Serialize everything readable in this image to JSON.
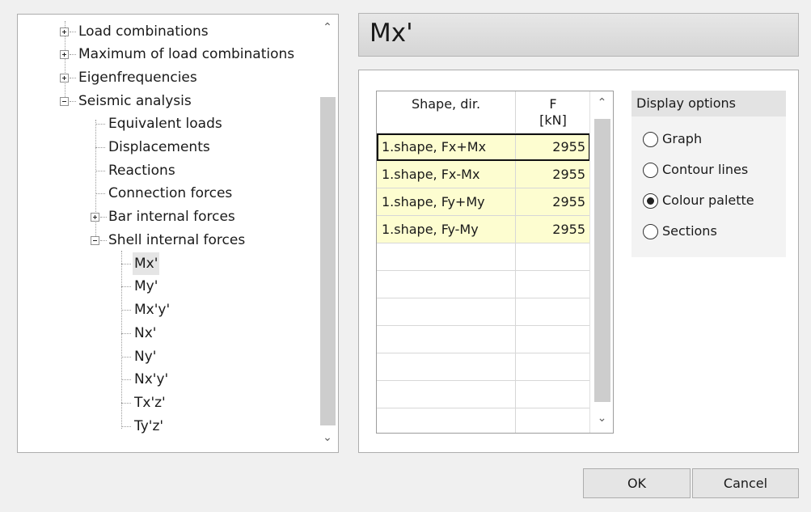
{
  "tree": {
    "items": [
      {
        "label": "Load combinations",
        "expander": "plus"
      },
      {
        "label": "Maximum of load combinations",
        "expander": "plus"
      },
      {
        "label": "Eigenfrequencies",
        "expander": "plus"
      },
      {
        "label": "Seismic analysis",
        "expander": "minus"
      },
      {
        "label": "Equivalent loads"
      },
      {
        "label": "Displacements"
      },
      {
        "label": "Reactions"
      },
      {
        "label": "Connection forces"
      },
      {
        "label": "Bar internal forces",
        "expander": "plus"
      },
      {
        "label": "Shell internal forces",
        "expander": "minus"
      },
      {
        "label": "Mx'",
        "selected": true
      },
      {
        "label": "My'"
      },
      {
        "label": "Mx'y'"
      },
      {
        "label": "Nx'"
      },
      {
        "label": "Ny'"
      },
      {
        "label": "Nx'y'"
      },
      {
        "label": "Tx'z'"
      },
      {
        "label": "Ty'z'"
      }
    ]
  },
  "header": {
    "title": "Mx'"
  },
  "grid": {
    "columns": [
      "Shape, dir.",
      "F",
      "[kN]"
    ],
    "rows": [
      {
        "shape": "1.shape, Fx+Mx",
        "f": "2955"
      },
      {
        "shape": "1.shape, Fx-Mx",
        "f": "2955"
      },
      {
        "shape": "1.shape, Fy+My",
        "f": "2955"
      },
      {
        "shape": "1.shape, Fy-My",
        "f": "2955"
      }
    ]
  },
  "display_options": {
    "title": "Display options",
    "options": [
      {
        "label": "Graph",
        "checked": false
      },
      {
        "label": "Contour lines",
        "checked": false
      },
      {
        "label": "Colour palette",
        "checked": true
      },
      {
        "label": "Sections",
        "checked": false
      }
    ]
  },
  "buttons": {
    "ok": "OK",
    "cancel": "Cancel"
  },
  "icons": {
    "scroll_up": "chevron-up-icon",
    "scroll_down": "chevron-down-icon"
  },
  "colors": {
    "filled_row": "#fdfdd0",
    "selected_tree": "#e5e5e5"
  }
}
